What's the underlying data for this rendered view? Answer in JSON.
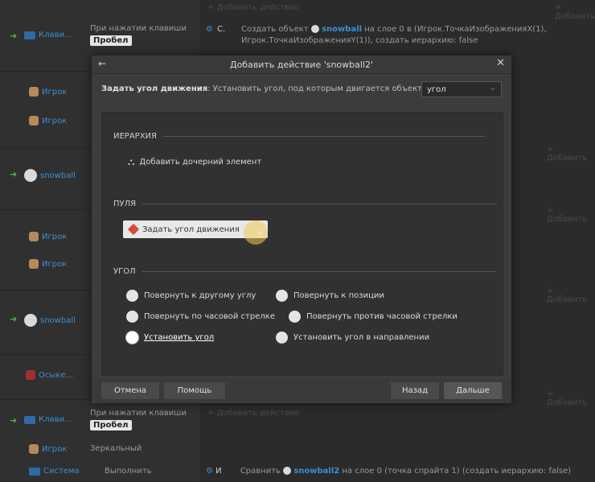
{
  "background": {
    "top_action": {
      "prefix": "Создать объект",
      "object": "snowball",
      "rest": "на слое 0 в (Игрок.ТочкаИзображенияX(1), Игрок.ТочкаИзображенияY(1)), создать иерархию: false"
    },
    "top_cond_label": "При нажатии клавиши",
    "top_key": "Пробел",
    "top_ev_label": "Клави...",
    "top_action_short": "С.",
    "top_add_action": "+ Добавить действие",
    "rows": [
      {
        "items": [
          {
            "label": "Игрок",
            "icon": "person-icon"
          },
          {
            "label": "Игрок",
            "icon": "person-icon"
          }
        ]
      },
      {
        "items": [
          {
            "label": "snowball",
            "icon": "ball-icon"
          }
        ]
      },
      {
        "items": [
          {
            "label": "Игрок",
            "icon": "person-icon"
          },
          {
            "label": "Игрок",
            "icon": "person-icon"
          }
        ]
      },
      {
        "items": [
          {
            "label": "snowball",
            "icon": "ball-icon"
          }
        ]
      },
      {
        "items": [
          {
            "label": "Осыке...",
            "icon": "fire-icon"
          }
        ]
      }
    ],
    "bottom_cond_label": "При нажатии клавиши",
    "bottom_key": "Пробел",
    "bottom_ev_label": "Клави...",
    "bottom_mirror": "Зеркальный",
    "bottom_player": "Игрок",
    "bottom_run": "Выполнить",
    "bottom_system": "Система",
    "bottom_action": {
      "prefix": "Сравнить",
      "object": "snowball2",
      "rest": "на слое 0 (точка спрайта 1) (создать иерархию: false)"
    },
    "bottom_action_short": "И",
    "add_labels": [
      "+ Добавить",
      "+ Добавить",
      "+ Добавить",
      "+ Добавить",
      "+ Добавить"
    ],
    "add_event": "+ Добавить действие"
  },
  "dialog": {
    "title": "Добавить действие 'snowball2'",
    "desc_bold": "Задать угол движения",
    "desc_rest": ": Установить угол, под которым двигается объект",
    "select_value": "угол",
    "sections": {
      "hierarchy": "ИЕРАРХИЯ",
      "bullet": "ПУЛЯ",
      "angle": "УГОЛ"
    },
    "hierarchy_item": "Добавить дочерний элемент",
    "bullet_item": "Задать угол движения",
    "options": [
      {
        "label": "Повернуть к другому углу",
        "active": false
      },
      {
        "label": "Повернуть к позиции",
        "active": false
      },
      {
        "label": "Повернуть по часовой стрелке",
        "active": false
      },
      {
        "label": "Повернуть против часовой стрелки",
        "active": false
      },
      {
        "label": "Установить угол",
        "active": true
      },
      {
        "label": "Установить угол в направлении",
        "active": false
      }
    ],
    "buttons": {
      "cancel": "Отмена",
      "help": "Помощь",
      "back": "Назад",
      "next": "Дальше"
    }
  }
}
